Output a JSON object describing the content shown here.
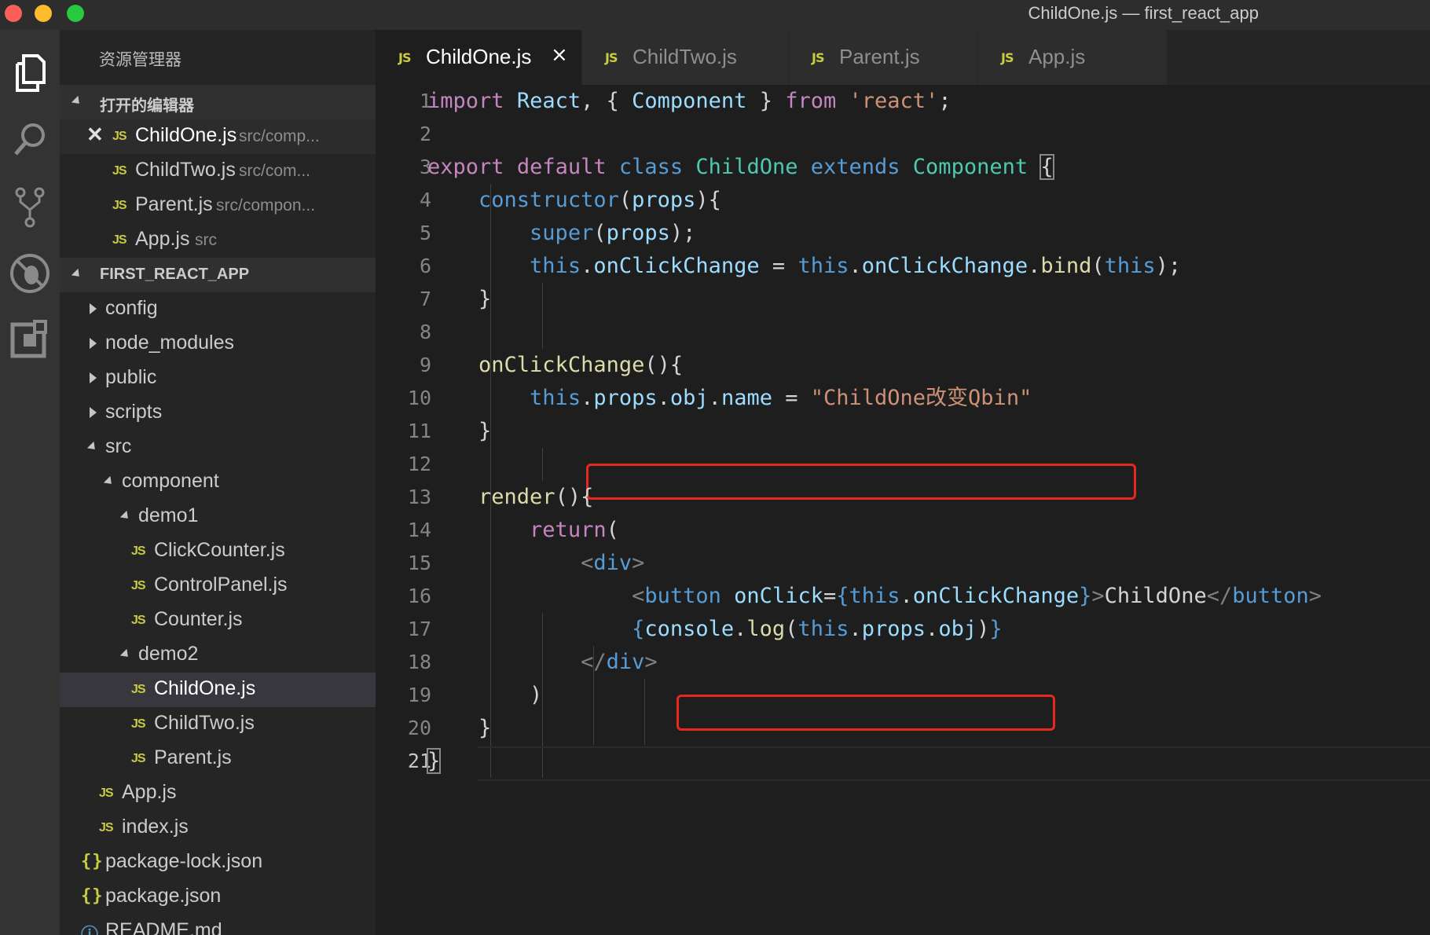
{
  "window": {
    "title": "ChildOne.js — first_react_app"
  },
  "activity_bar": {
    "icons": [
      "files-icon",
      "search-icon",
      "source-control-icon",
      "debug-icon",
      "extensions-icon"
    ]
  },
  "sidebar": {
    "title": "资源管理器",
    "open_editors": {
      "header": "打开的编辑器",
      "items": [
        {
          "badge": "JS",
          "name": "ChildOne.js",
          "path": "src/comp...",
          "active": true
        },
        {
          "badge": "JS",
          "name": "ChildTwo.js",
          "path": "src/com..."
        },
        {
          "badge": "JS",
          "name": "Parent.js",
          "path": "src/compon..."
        },
        {
          "badge": "JS",
          "name": "App.js",
          "path": "src"
        }
      ]
    },
    "project": {
      "header": "FIRST_REACT_APP",
      "tree": [
        {
          "name": "config",
          "kind": "folder",
          "expanded": false
        },
        {
          "name": "node_modules",
          "kind": "folder",
          "expanded": false
        },
        {
          "name": "public",
          "kind": "folder",
          "expanded": false
        },
        {
          "name": "scripts",
          "kind": "folder",
          "expanded": false
        },
        {
          "name": "src",
          "kind": "folder",
          "expanded": true
        },
        {
          "name": "component",
          "kind": "folder",
          "expanded": true
        },
        {
          "name": "demo1",
          "kind": "folder",
          "expanded": true
        },
        {
          "name": "ClickCounter.js",
          "kind": "js"
        },
        {
          "name": "ControlPanel.js",
          "kind": "js"
        },
        {
          "name": "Counter.js",
          "kind": "js"
        },
        {
          "name": "demo2",
          "kind": "folder",
          "expanded": true
        },
        {
          "name": "ChildOne.js",
          "kind": "js",
          "selected": true
        },
        {
          "name": "ChildTwo.js",
          "kind": "js"
        },
        {
          "name": "Parent.js",
          "kind": "js"
        },
        {
          "name": "App.js",
          "kind": "js"
        },
        {
          "name": "index.js",
          "kind": "js"
        },
        {
          "name": "package-lock.json",
          "kind": "json"
        },
        {
          "name": "package.json",
          "kind": "json"
        },
        {
          "name": "README.md",
          "kind": "info"
        }
      ],
      "json_badge": "{}",
      "info_badge": "ⓘ"
    }
  },
  "tabs": [
    {
      "badge": "JS",
      "label": "ChildOne.js",
      "active": true,
      "close": "×"
    },
    {
      "badge": "JS",
      "label": "ChildTwo.js"
    },
    {
      "badge": "JS",
      "label": "Parent.js"
    },
    {
      "badge": "JS",
      "label": "App.js"
    }
  ],
  "editor": {
    "current_line": 21,
    "highlighted_lines": [
      10,
      17
    ],
    "highlight_color": "#e8281c",
    "lines": [
      {
        "n": "1",
        "tokens": [
          [
            "k",
            "import"
          ],
          [
            "p",
            " "
          ],
          [
            "v",
            "React"
          ],
          [
            "p",
            ", { "
          ],
          [
            "v",
            "Component"
          ],
          [
            "p",
            " } "
          ],
          [
            "k",
            "from"
          ],
          [
            "p",
            " "
          ],
          [
            "s",
            "'react'"
          ],
          [
            "p",
            ";"
          ]
        ]
      },
      {
        "n": "2",
        "tokens": []
      },
      {
        "n": "3",
        "tokens": [
          [
            "k",
            "export"
          ],
          [
            "p",
            " "
          ],
          [
            "k",
            "default"
          ],
          [
            "p",
            " "
          ],
          [
            "b",
            "class"
          ],
          [
            "p",
            " "
          ],
          [
            "c",
            "ChildOne"
          ],
          [
            "p",
            " "
          ],
          [
            "b",
            "extends"
          ],
          [
            "p",
            " "
          ],
          [
            "c",
            "Component"
          ],
          [
            "p",
            " "
          ],
          [
            "pb",
            "{"
          ]
        ]
      },
      {
        "n": "4",
        "tokens": [
          [
            "p",
            "    "
          ],
          [
            "b",
            "constructor"
          ],
          [
            "p",
            "("
          ],
          [
            "v",
            "props"
          ],
          [
            "p",
            "){"
          ]
        ]
      },
      {
        "n": "5",
        "tokens": [
          [
            "p",
            "        "
          ],
          [
            "b",
            "super"
          ],
          [
            "p",
            "("
          ],
          [
            "v",
            "props"
          ],
          [
            "p",
            ");"
          ]
        ]
      },
      {
        "n": "6",
        "tokens": [
          [
            "p",
            "        "
          ],
          [
            "b",
            "this"
          ],
          [
            "p",
            "."
          ],
          [
            "v",
            "onClickChange"
          ],
          [
            "p",
            " = "
          ],
          [
            "b",
            "this"
          ],
          [
            "p",
            "."
          ],
          [
            "v",
            "onClickChange"
          ],
          [
            "p",
            "."
          ],
          [
            "f",
            "bind"
          ],
          [
            "p",
            "("
          ],
          [
            "b",
            "this"
          ],
          [
            "p",
            ");"
          ]
        ]
      },
      {
        "n": "7",
        "tokens": [
          [
            "p",
            "    }"
          ]
        ]
      },
      {
        "n": "8",
        "tokens": []
      },
      {
        "n": "9",
        "tokens": [
          [
            "p",
            "    "
          ],
          [
            "f",
            "onClickChange"
          ],
          [
            "p",
            "(){"
          ]
        ]
      },
      {
        "n": "10",
        "tokens": [
          [
            "p",
            "        "
          ],
          [
            "b",
            "this"
          ],
          [
            "p",
            "."
          ],
          [
            "v",
            "props"
          ],
          [
            "p",
            "."
          ],
          [
            "v",
            "obj"
          ],
          [
            "p",
            "."
          ],
          [
            "v",
            "name"
          ],
          [
            "p",
            " = "
          ],
          [
            "s",
            "\"ChildOne改变Qbin\""
          ]
        ]
      },
      {
        "n": "11",
        "tokens": [
          [
            "p",
            "    }"
          ]
        ]
      },
      {
        "n": "12",
        "tokens": []
      },
      {
        "n": "13",
        "tokens": [
          [
            "p",
            "    "
          ],
          [
            "f",
            "render"
          ],
          [
            "p",
            "(){"
          ]
        ]
      },
      {
        "n": "14",
        "tokens": [
          [
            "p",
            "        "
          ],
          [
            "k",
            "return"
          ],
          [
            "p",
            "("
          ]
        ]
      },
      {
        "n": "15",
        "tokens": [
          [
            "p",
            "            "
          ],
          [
            "t",
            "<"
          ],
          [
            "b",
            "div"
          ],
          [
            "t",
            ">"
          ]
        ]
      },
      {
        "n": "16",
        "tokens": [
          [
            "p",
            "                "
          ],
          [
            "t",
            "<"
          ],
          [
            "b",
            "button"
          ],
          [
            "p",
            " "
          ],
          [
            "v",
            "onClick"
          ],
          [
            "p",
            "="
          ],
          [
            "b",
            "{"
          ],
          [
            "b",
            "this"
          ],
          [
            "p",
            "."
          ],
          [
            "v",
            "onClickChange"
          ],
          [
            "b",
            "}"
          ],
          [
            "t",
            ">"
          ],
          [
            "p",
            "ChildOne"
          ],
          [
            "t",
            "</"
          ],
          [
            "b",
            "button"
          ],
          [
            "t",
            ">"
          ]
        ]
      },
      {
        "n": "17",
        "tokens": [
          [
            "p",
            "                "
          ],
          [
            "b",
            "{"
          ],
          [
            "v",
            "console"
          ],
          [
            "p",
            "."
          ],
          [
            "f",
            "log"
          ],
          [
            "p",
            "("
          ],
          [
            "b",
            "this"
          ],
          [
            "p",
            "."
          ],
          [
            "v",
            "props"
          ],
          [
            "p",
            "."
          ],
          [
            "v",
            "obj"
          ],
          [
            "p",
            ")"
          ],
          [
            "b",
            "}"
          ]
        ]
      },
      {
        "n": "18",
        "tokens": [
          [
            "p",
            "            "
          ],
          [
            "t",
            "</"
          ],
          [
            "b",
            "div"
          ],
          [
            "t",
            ">"
          ]
        ]
      },
      {
        "n": "19",
        "tokens": [
          [
            "p",
            "        )"
          ]
        ]
      },
      {
        "n": "20",
        "tokens": [
          [
            "p",
            "    }"
          ]
        ]
      },
      {
        "n": "21",
        "tokens": [
          [
            "pb",
            "}"
          ]
        ]
      }
    ]
  }
}
